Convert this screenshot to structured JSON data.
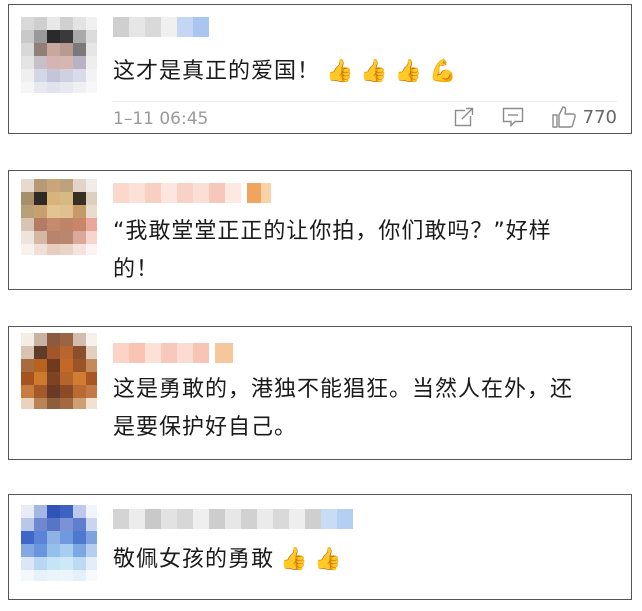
{
  "comments": [
    {
      "text": "这才是真正的爱国！",
      "emojis": [
        "👍",
        "👍",
        "👍",
        "💪"
      ],
      "timestamp": "1–11 06:45",
      "likes": "770",
      "icons": [
        "share-icon",
        "comment-icon",
        "like-icon"
      ]
    },
    {
      "text_line1": "“我敢堂堂正正的让你拍，你们敢吗？”好样",
      "text_line2": "的！"
    },
    {
      "text_line1": "这是勇敢的，港独不能猖狂。当然人在外，还",
      "text_line2": "是要保护好自己。"
    },
    {
      "text": "敬佩女孩的勇敢",
      "emojis": [
        "👍",
        "👍"
      ]
    }
  ],
  "colors": {
    "border": "#555555",
    "meta_text": "#9a9a9a",
    "body_text": "#1a1a1a"
  }
}
